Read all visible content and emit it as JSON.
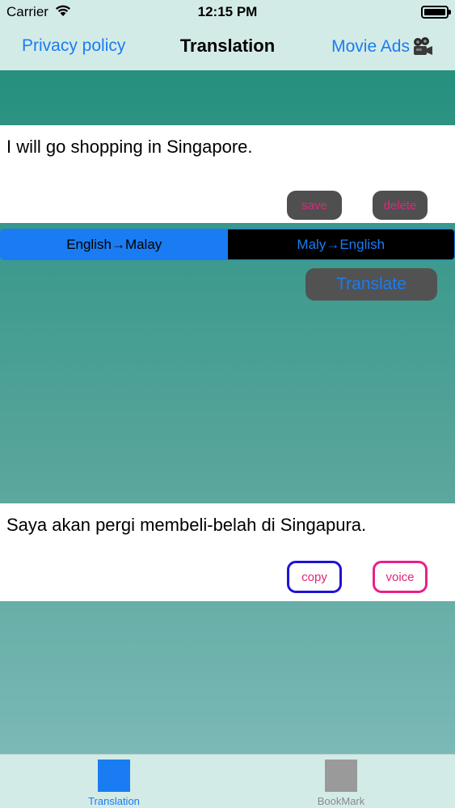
{
  "status_bar": {
    "carrier": "Carrier",
    "time": "12:15 PM",
    "icons": [
      "wifi-icon",
      "battery-icon"
    ]
  },
  "nav": {
    "left_link": "Privacy policy",
    "title": "Translation",
    "right_link": "Movie Ads",
    "right_icon": "movie-camera-icon"
  },
  "input": {
    "text": "I will go shopping in Singapore.",
    "save_label": "save",
    "delete_label": "delete"
  },
  "direction": {
    "options": [
      "English→Malay",
      "Maly→English"
    ],
    "selected": "English→Malay"
  },
  "translate_label": "Translate",
  "output": {
    "text": "Saya akan pergi membeli-belah di Singapura.",
    "copy_label": "copy",
    "voice_label": "voice"
  },
  "tabs": [
    {
      "label": "Translation",
      "active": true
    },
    {
      "label": "BookMark",
      "active": false
    }
  ],
  "colors": {
    "accent": "#1a7cf2",
    "button_text": "#e0267a",
    "bar_background": "#d3ebe7",
    "copy_border": "#1f12d6",
    "voice_border": "#e9208a"
  }
}
